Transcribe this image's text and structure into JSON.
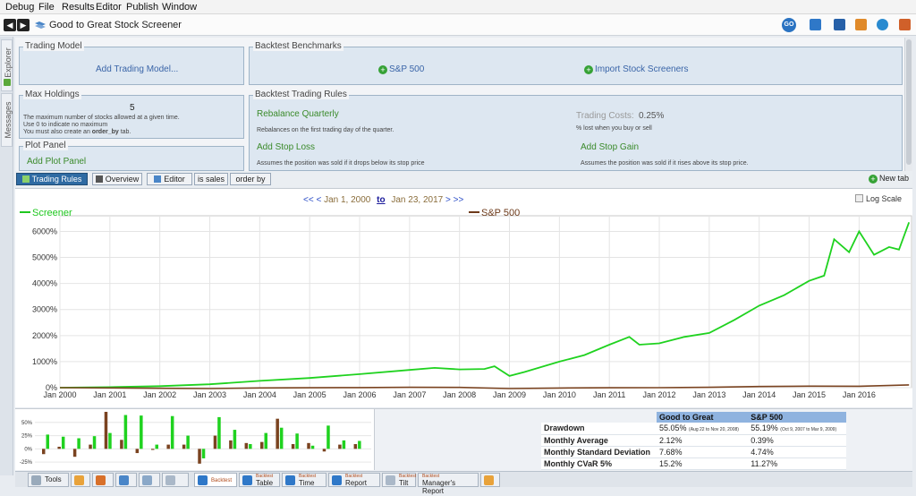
{
  "menu": [
    "Debug",
    "File",
    "Results",
    "Editor",
    "Publish",
    "Window"
  ],
  "app": {
    "title": "Good to Great Stock Screener"
  },
  "sidebar": {
    "explorer": "Explorer",
    "messages": "Messages"
  },
  "panels": {
    "trading_model": {
      "legend": "Trading Model",
      "link": "Add Trading Model..."
    },
    "benchmarks": {
      "legend": "Backtest Benchmarks",
      "items": [
        "S&P 500",
        "Import Stock Screeners"
      ]
    },
    "max_holdings": {
      "legend": "Max Holdings",
      "value": "5",
      "desc1": "The maximum number of stocks allowed at a given time.",
      "desc2": "Use 0 to indicate no maximum",
      "desc3_pre": "You must also create an",
      "desc3_code": "order_by",
      "desc3_post": "tab."
    },
    "trading_rules": {
      "legend": "Backtest Trading Rules",
      "rebalance": "Rebalance Quarterly",
      "rebalance_desc": "Rebalances on the first trading day of the quarter.",
      "costs_label": "Trading Costs:",
      "costs_value": "0.25%",
      "costs_desc": "% lost when you buy or sell",
      "stop_loss": "Add Stop Loss",
      "stop_loss_desc": "Assumes the position was sold if it drops below its stop price",
      "stop_gain": "Add Stop Gain",
      "stop_gain_desc": "Assumes the position was sold if it rises above its stop price."
    },
    "plot_panel": {
      "legend": "Plot Panel",
      "link": "Add Plot Panel"
    }
  },
  "tabs": [
    "Trading Rules",
    "Overview",
    "Editor",
    "is sales",
    "order by"
  ],
  "new_tab": "New tab",
  "range": {
    "prev_all": "<<",
    "prev": "<",
    "start": "Jan 1, 2000",
    "to": "to",
    "end": "Jan 23, 2017",
    "next": ">",
    "next_all": ">>"
  },
  "log_scale": "Log Scale",
  "colors": {
    "screener": "#1fd21f",
    "sp500": "#7a4320",
    "accent": "#2f6ba3"
  },
  "chart_data": {
    "type": "line",
    "series": [
      {
        "name": "Screener",
        "x": [
          2000.0,
          2001.0,
          2002.0,
          2003.0,
          2004.0,
          2005.0,
          2006.0,
          2007.0,
          2007.5,
          2008.0,
          2008.5,
          2008.7,
          2009.0,
          2009.3,
          2010.0,
          2010.5,
          2011.0,
          2011.4,
          2011.6,
          2012.0,
          2012.5,
          2013.0,
          2013.5,
          2014.0,
          2014.5,
          2015.0,
          2015.3,
          2015.5,
          2015.8,
          2016.0,
          2016.3,
          2016.6,
          2016.8,
          2017.0
        ],
        "values": [
          0,
          20,
          60,
          130,
          260,
          370,
          520,
          680,
          760,
          700,
          720,
          820,
          450,
          600,
          1000,
          1250,
          1650,
          1950,
          1650,
          1700,
          1950,
          2100,
          2600,
          3150,
          3550,
          4100,
          4300,
          5700,
          5200,
          6000,
          5100,
          5400,
          5300,
          6350
        ]
      },
      {
        "name": "S&P 500",
        "x": [
          2000,
          2001,
          2002,
          2003,
          2004,
          2005,
          2006,
          2007,
          2008,
          2009,
          2010,
          2011,
          2012,
          2013,
          2014,
          2015,
          2016,
          2017
        ],
        "values": [
          0,
          -10,
          -25,
          -35,
          -10,
          -5,
          5,
          15,
          10,
          -35,
          -15,
          -5,
          0,
          15,
          45,
          60,
          55,
          105
        ]
      }
    ],
    "xlabels": [
      "Jan 2000",
      "Jan 2001",
      "Jan 2002",
      "Jan 2003",
      "Jan 2004",
      "Jan 2005",
      "Jan 2006",
      "Jan 2007",
      "Jan 2008",
      "Jan 2009",
      "Jan 2010",
      "Jan 2011",
      "Jan 2012",
      "Jan 2013",
      "Jan 2014",
      "Jan 2015",
      "Jan 2016"
    ],
    "yticks": [
      0,
      1000,
      2000,
      3000,
      4000,
      5000,
      6000
    ],
    "ylabels": [
      "0%",
      "1000%",
      "2000%",
      "3000%",
      "4000%",
      "5000%",
      "6000%"
    ],
    "ylim": [
      0,
      6600
    ],
    "xlim": [
      2000,
      2017.05
    ],
    "grid": true
  },
  "mini_chart": {
    "type": "bar",
    "ylabels": [
      "50%",
      "25%",
      "0%",
      "-25%"
    ],
    "yticks": [
      50,
      25,
      0,
      -25
    ],
    "ylim": [
      -35,
      70
    ],
    "pairs": [
      [
        -10,
        27
      ],
      [
        4,
        23
      ],
      [
        -15,
        20
      ],
      [
        8,
        24
      ],
      [
        70,
        30
      ],
      [
        17,
        64
      ],
      [
        -8,
        63
      ],
      [
        -2,
        8
      ],
      [
        8,
        62
      ],
      [
        8,
        25
      ],
      [
        -28,
        -18
      ],
      [
        25,
        60
      ],
      [
        16,
        36
      ],
      [
        11,
        9
      ],
      [
        13,
        30
      ],
      [
        57,
        40
      ],
      [
        9,
        29
      ],
      [
        11,
        6
      ],
      [
        -5,
        44
      ],
      [
        8,
        16
      ],
      [
        9,
        15
      ]
    ]
  },
  "stats": {
    "headers": [
      "",
      "Good to Great",
      "S&P 500"
    ],
    "rows": [
      {
        "label": "Drawdown",
        "a": "55.05%",
        "a_note": "(Aug 22 to Nov 20, 2008)",
        "b": "55.19%",
        "b_note": "(Oct 9, 2007 to Mar 9, 2009)"
      },
      {
        "label": "Monthly Average",
        "a": "2.12%",
        "a_note": "",
        "b": "0.39%",
        "b_note": ""
      },
      {
        "label": "Monthly Standard Deviation",
        "a": "7.68%",
        "a_note": "",
        "b": "4.74%",
        "b_note": ""
      },
      {
        "label": "Monthly CVaR 5%",
        "a": "15.2%",
        "a_note": "",
        "b": "11.27%",
        "b_note": ""
      }
    ]
  },
  "bottom_tabs": [
    {
      "top": "",
      "label": "Tools"
    },
    {
      "top": "",
      "label": ""
    },
    {
      "top": "",
      "label": ""
    },
    {
      "top": "",
      "label": ""
    },
    {
      "top": "",
      "label": ""
    },
    {
      "top": "",
      "label": ""
    },
    {
      "top": "",
      "label": "Backtest"
    },
    {
      "top": "Backtest",
      "label": "Table"
    },
    {
      "top": "Backtest",
      "label": "Time"
    },
    {
      "top": "Backtest",
      "label": "Report"
    },
    {
      "top": "Backtest",
      "label": "Tilt"
    },
    {
      "top": "Backtest",
      "label": "Manager's Report"
    },
    {
      "top": "",
      "label": ""
    }
  ]
}
